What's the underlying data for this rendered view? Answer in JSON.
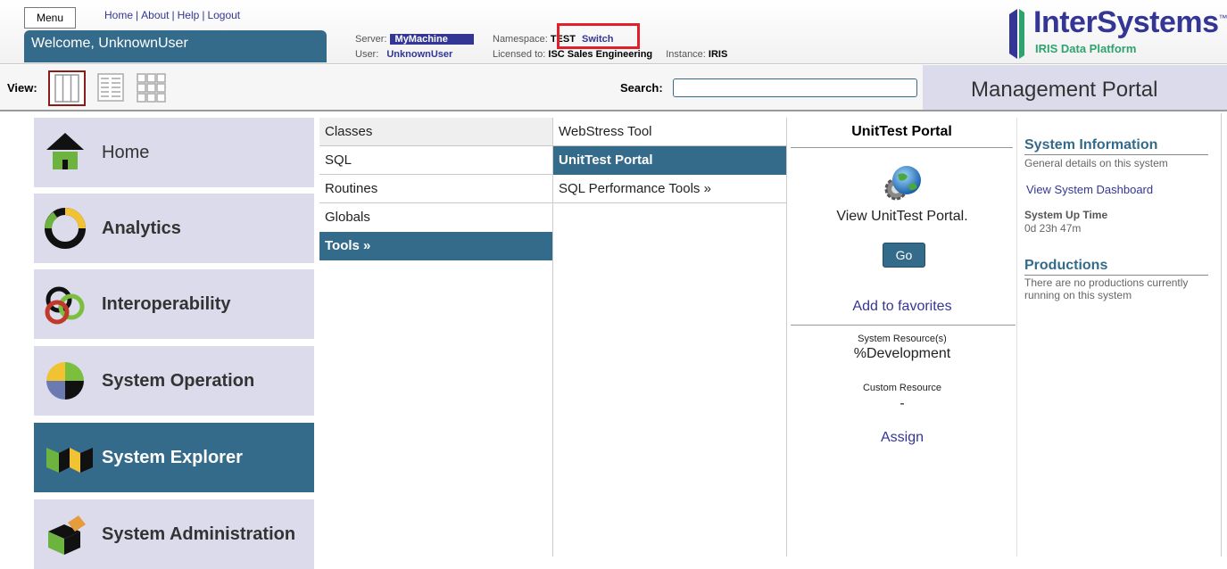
{
  "header": {
    "menu_label": "Menu",
    "links": [
      "Home",
      "About",
      "Help",
      "Logout"
    ],
    "welcome": "Welcome, UnknownUser",
    "server_label": "Server:",
    "server_value": "MyMachine",
    "user_label": "User:",
    "user_value": "UnknownUser",
    "namespace_label": "Namespace:",
    "namespace_value": "TEST",
    "namespace_switch": "Switch",
    "licensed_label": "Licensed to:",
    "licensed_value": "ISC Sales Engineering",
    "instance_label": "Instance:",
    "instance_value": "IRIS",
    "logo_text": "InterSystems",
    "logo_tm": "™",
    "logo_sub": "IRIS Data Platform",
    "highlight_color": "#e0202a"
  },
  "viewbar": {
    "view_label": "View:",
    "search_label": "Search:",
    "search_value": "",
    "portal_title": "Management Portal"
  },
  "nav": {
    "items": [
      {
        "label": "Home",
        "icon": "home-icon"
      },
      {
        "label": "Analytics",
        "icon": "analytics-icon"
      },
      {
        "label": "Interoperability",
        "icon": "interoperability-icon"
      },
      {
        "label": "System Operation",
        "icon": "system-operation-icon"
      },
      {
        "label": "System Explorer",
        "icon": "system-explorer-icon",
        "active": true
      },
      {
        "label": "System Administration",
        "icon": "system-administration-icon"
      }
    ]
  },
  "col1": {
    "items": [
      "Classes",
      "SQL",
      "Routines",
      "Globals",
      "Tools »"
    ],
    "selected": "Tools »"
  },
  "col2": {
    "items": [
      "WebStress Tool",
      "UnitTest Portal",
      "SQL Performance Tools »"
    ],
    "selected": "UnitTest Portal"
  },
  "detail": {
    "title": "UnitTest Portal",
    "description": "View UnitTest Portal.",
    "go_label": "Go",
    "favorites_label": "Add to favorites",
    "resource_label": "System Resource(s)",
    "resource_value": "%Development",
    "custom_resource_label": "Custom Resource",
    "custom_resource_value": "-",
    "assign_label": "Assign"
  },
  "info": {
    "system_info_title": "System Information",
    "system_info_sub": "General details on this system",
    "dashboard_link": "View System Dashboard",
    "uptime_label": "System Up Time",
    "uptime_value": "0d 23h 47m",
    "productions_title": "Productions",
    "productions_sub": "There are no productions currently running on this system"
  },
  "colors": {
    "accent": "#356b8a",
    "nav_bg": "#dbdbeb",
    "link": "#333695",
    "logo_green": "#2ea36f"
  }
}
